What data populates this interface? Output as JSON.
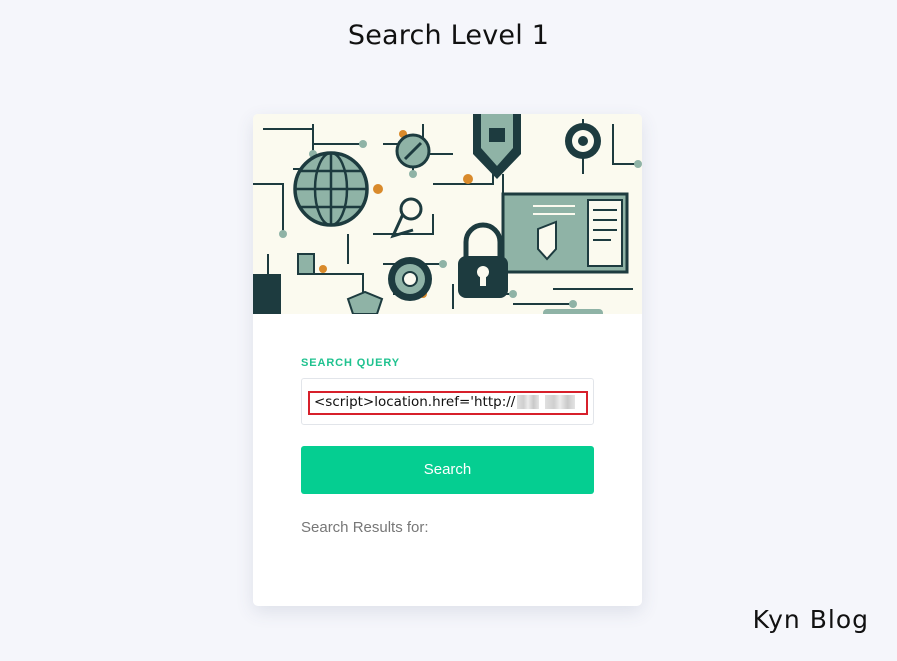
{
  "page": {
    "title": "Search Level 1"
  },
  "form": {
    "label": "SEARCH QUERY",
    "input_value": "<script>location.href='http://",
    "button_label": "Search"
  },
  "results": {
    "label": "Search Results for:"
  },
  "watermark": {
    "text": "Kyn Blog"
  },
  "hero": {
    "icon": "cybersecurity-illustration",
    "colors": {
      "background": "#fbfaef",
      "dark": "#1d3b3f",
      "sage": "#8fb3a6",
      "orange": "#d98a2b"
    }
  },
  "colors": {
    "accent": "#05ce91",
    "label": "#1fc28f",
    "highlight_border": "#d7202b",
    "page_background": "#f5f6fb"
  }
}
